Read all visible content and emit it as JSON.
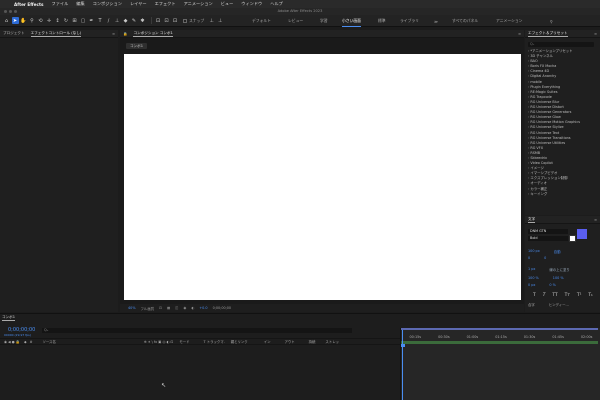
{
  "menubar": {
    "app": "After Effects",
    "items": [
      "ファイル",
      "編集",
      "コンポジション",
      "レイヤー",
      "エフェクト",
      "アニメーション",
      "ビュー",
      "ウィンドウ",
      "ヘルプ"
    ]
  },
  "window": {
    "title": "Adobe After Effects 2023"
  },
  "toolbar": {
    "snap_label": "スナップ",
    "workspaces": [
      {
        "label": "デフォルト",
        "active": false
      },
      {
        "label": "レビュー",
        "active": false
      },
      {
        "label": "学習",
        "active": false
      },
      {
        "label": "小さい画面",
        "active": true
      },
      {
        "label": "標準",
        "active": false
      },
      {
        "label": "ライブラリ",
        "active": false
      },
      {
        "label": "≫",
        "active": false
      },
      {
        "label": "すべてのパネル",
        "active": false
      },
      {
        "label": "アニメーション",
        "active": false
      }
    ]
  },
  "project_panel": {
    "tabs": [
      "プロジェクト",
      "エフェクトコントロール (なし)"
    ]
  },
  "viewer": {
    "header": "コンポジション コンポ1",
    "comp_tab": "コンポ1",
    "zoom": "40%",
    "resolution": "フル画質",
    "exposure": "+0.0",
    "timecode": "0;00;00;00"
  },
  "effects_panel": {
    "title": "エフェクト＆プリセット",
    "search_placeholder": "Q₊",
    "items": [
      "*アニメーションプリセット",
      "3D チャンネル",
      "BAO",
      "Boris FX Mocha",
      "Cinema 4D",
      "Digital Anarchy",
      "mobile",
      "Plugin Everything",
      "RE:Magic Suites",
      "RG Trapcode",
      "RG Universe Blur",
      "RG Universe Distort",
      "RG Universe Generators",
      "RG Universe Glow",
      "RG Universe Motion Graphics",
      "RG Universe Stylize",
      "RG Universe Text",
      "RG Universe Transitions",
      "RG Universe Utilities",
      "RG VFX",
      "RSMB",
      "Skkeedrix",
      "Video Copilot",
      "イメージ",
      "イマーシブビデオ",
      "エクスプレッション制御",
      "オーディオ",
      "カラー補正",
      "キーイング"
    ]
  },
  "character_panel": {
    "title": "文字",
    "font": "DNM GTN",
    "style": "Bold",
    "size": "100 px",
    "leading": "自動",
    "kerning": "0",
    "tracking": "0",
    "stroke": "1 px",
    "stroke_mode": "線の上に塗り",
    "vscale": "100 %",
    "hscale": "100 %",
    "baseline": "0 px",
    "tsume": "0 %",
    "style_buttons": [
      "T",
      "T",
      "TT",
      "Tᴛ",
      "T¹",
      "T₁"
    ],
    "ligature": "合字",
    "hindi": "ヒンディー...",
    "fill_color": "#5a5ef0",
    "stroke_color": "#ffffff"
  },
  "timeline": {
    "tab": "コンポ1",
    "timecode": "0;00;00;00",
    "timecode_sub": "00000 (29.97 fps)",
    "search_placeholder": "Q₊",
    "columns": [
      "ソース名",
      "モード",
      "T トラックマ.",
      "親とリンク",
      "イン",
      "アウト",
      "持続",
      "ストレッ"
    ],
    "ruler": [
      "00:15s",
      "00:30s",
      "01:00s",
      "01:15s",
      "01:30s",
      "01:45s",
      "02:00s"
    ],
    "accent": "#4a8df0"
  }
}
